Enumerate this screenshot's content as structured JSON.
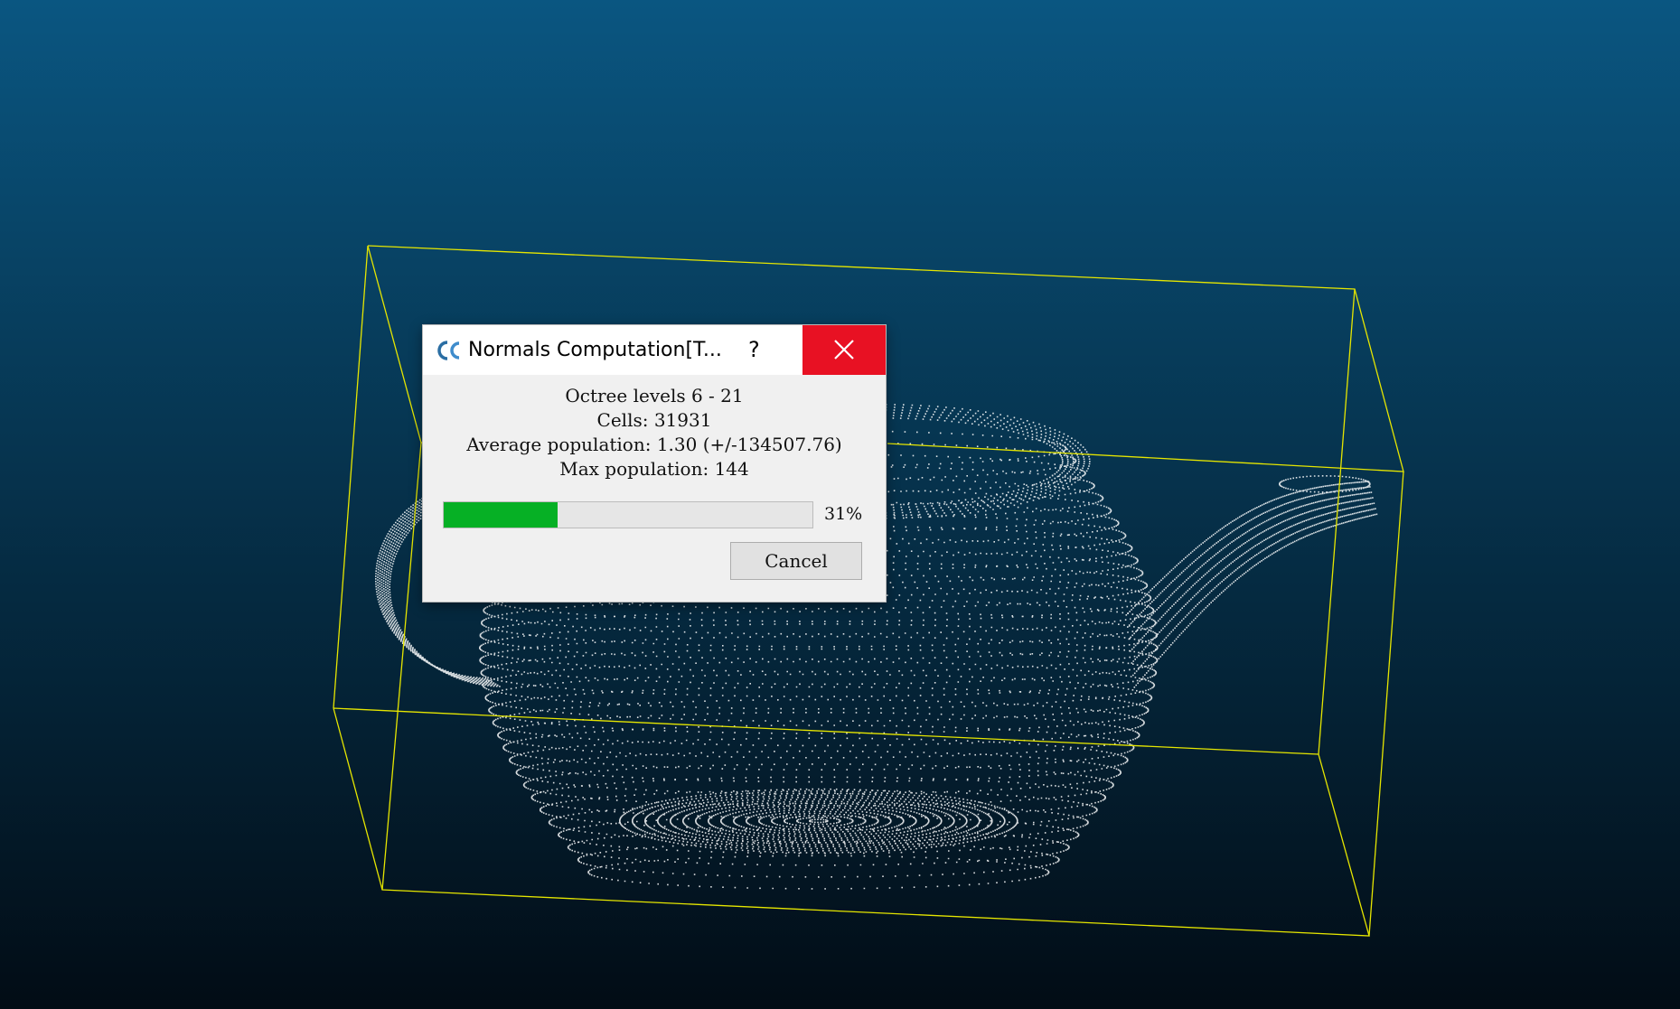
{
  "scene": {
    "background_top": "#0a5681",
    "background_bottom": "#020c15",
    "bbox_color": "#e6e600",
    "points_color": "#ffffff",
    "object": "teapot point cloud"
  },
  "dialog": {
    "title": "Normals Computation[T...",
    "app_icon": "cloudcompare-logo-icon",
    "help_label": "?",
    "close_icon": "close-icon",
    "close_color": "#e81123",
    "info": {
      "octree_levels": "Octree levels 6 - 21",
      "cells": "Cells: 31931",
      "average_population": "Average population: 1.30 (+/-134507.76)",
      "max_population": "Max population: 144"
    },
    "progress": {
      "value": 0.31,
      "label": "31%",
      "fill_color": "#06b025"
    },
    "cancel_label": "Cancel"
  }
}
